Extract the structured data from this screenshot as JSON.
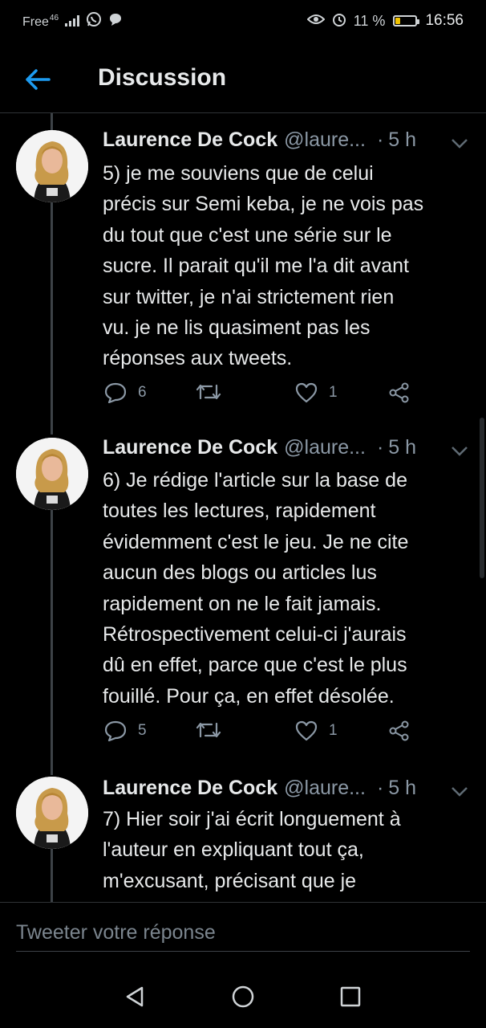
{
  "status_bar": {
    "carrier": "Free",
    "network": "46",
    "battery_percent": "11 %",
    "battery_level": 0.11,
    "time": "16:56"
  },
  "header": {
    "title": "Discussion"
  },
  "tweets": [
    {
      "name": "Laurence De Cock",
      "handle": "@laure...",
      "dot": "·",
      "time": "5 h",
      "lines": [
        "5) je me souviens que de celui",
        "précis sur Semi keba, je ne vois pas",
        "du tout que c'est une série sur le",
        "sucre. Il parait qu'il me l'a dit avant",
        "sur twitter, je n'ai strictement rien",
        "vu. je ne lis quasiment pas les",
        "réponses aux tweets."
      ],
      "replies": "6",
      "retweets": "",
      "likes": "1"
    },
    {
      "name": "Laurence De Cock",
      "handle": "@laure...",
      "dot": "·",
      "time": "5 h",
      "lines": [
        "6) Je rédige l'article sur la base de",
        "toutes les lectures, rapidement",
        "évidemment c'est le jeu. Je ne cite",
        "aucun des blogs ou articles lus",
        "rapidement on ne le fait jamais.",
        "Rétrospectivement celui-ci j'aurais",
        "dû en effet, parce que c'est le plus",
        "fouillé. Pour ça, en effet désolée."
      ],
      "replies": "5",
      "retweets": "",
      "likes": "1"
    },
    {
      "name": "Laurence De Cock",
      "handle": "@laure...",
      "dot": "·",
      "time": "5 h",
      "lines": [
        "7) Hier soir j'ai écrit longuement à",
        "l'auteur en expliquant tout ça,",
        "m'excusant, précisant que je"
      ]
    }
  ],
  "reply_bar": {
    "placeholder": "Tweeter votre réponse"
  },
  "colors": {
    "accent": "#1d9bf0",
    "background": "#000000",
    "text": "#e7e9ea",
    "muted": "#8b98a5",
    "battery": "#f2c300"
  }
}
